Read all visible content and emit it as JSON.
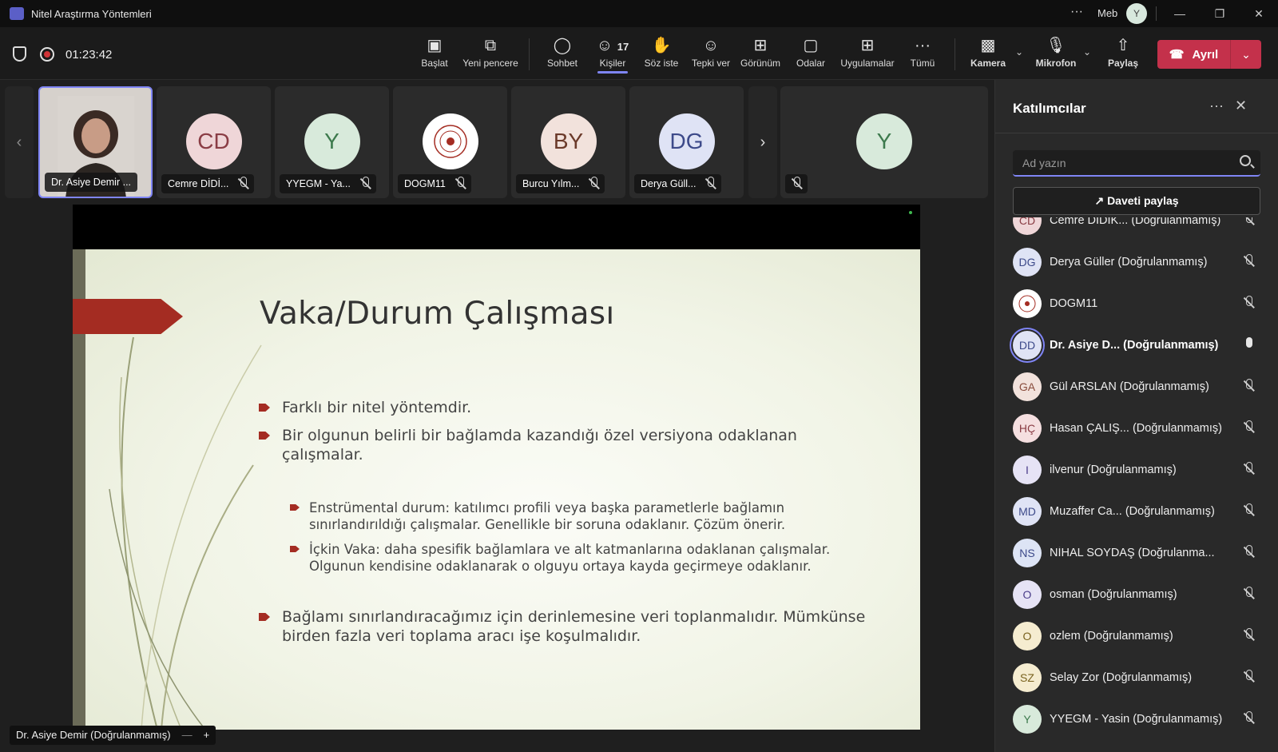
{
  "window": {
    "title": "Nitel Araştırma Yöntemleri",
    "org": "Meb",
    "account_initial": "Y",
    "more": "···"
  },
  "toolbar": {
    "timer": "01:23:42",
    "buttons": [
      {
        "label": "Başlat",
        "icon": "screen-pointer-icon"
      },
      {
        "label": "Yeni pencere",
        "icon": "new-window-icon"
      },
      {
        "label": "Sohbet",
        "icon": "chat-icon"
      },
      {
        "label": "Kişiler",
        "icon": "people-icon",
        "count": "17"
      },
      {
        "label": "Söz iste",
        "icon": "raise-hand-icon"
      },
      {
        "label": "Tepki ver",
        "icon": "reaction-icon"
      },
      {
        "label": "Görünüm",
        "icon": "view-icon"
      },
      {
        "label": "Odalar",
        "icon": "rooms-icon"
      },
      {
        "label": "Uygulamalar",
        "icon": "apps-icon"
      },
      {
        "label": "Tümü",
        "icon": "more-icon"
      },
      {
        "label": "Kamera",
        "icon": "camera-off-icon"
      },
      {
        "label": "Mikrofon",
        "icon": "mic-off-icon"
      },
      {
        "label": "Paylaş",
        "icon": "share-icon"
      }
    ],
    "leave_label": "Ayrıl"
  },
  "gallery": {
    "tiles": [
      {
        "name": "Dr. Asiye Demir ...",
        "initials": "",
        "color": "#d6d1cc"
      },
      {
        "name": "Cemre DİDİ...",
        "initials": "CD",
        "color": "#efd6d8"
      },
      {
        "name": "YYEGM - Ya...",
        "initials": "Y",
        "color": "#d8eadb"
      },
      {
        "name": "DOGM11",
        "initials": "",
        "color": "#ffffff"
      },
      {
        "name": "Burcu Yılm...",
        "initials": "BY",
        "color": "#f2e2dc"
      },
      {
        "name": "Derya Güll...",
        "initials": "DG",
        "color": "#dfe3f5"
      },
      {
        "name": "",
        "initials": "Y",
        "color": "#d8eadb"
      }
    ]
  },
  "slide": {
    "title": "Vaka/Durum Çalışması",
    "bullets": [
      "Farklı bir nitel yöntemdir.",
      "Bir olgunun belirli bir bağlamda kazandığı özel versiyona odaklanan çalışmalar."
    ],
    "sub_bullets": [
      "Enstrümental durum: katılımcı profili veya başka parametlerle bağlamın sınırlandırıldığı çalışmalar. Genellikle bir soruna odaklanır. Çözüm önerir.",
      "İçkin Vaka: daha spesifik bağlamlara ve alt katmanlarına odaklanan çalışmalar. Olgunun kendisine odaklanarak o olguyu ortaya kayda geçirmeye odaklanır."
    ],
    "final_bullet": "Bağlamı sınırlandıracağımız için derinlemesine veri toplanmalıdır. Mümkünse birden fazla veri toplama aracı işe koşulmalıdır."
  },
  "caption": {
    "presenter": "Dr. Asiye Demir (Doğrulanmamış)",
    "minus": "—",
    "plus": "+"
  },
  "panel": {
    "title": "Katılımcılar",
    "search_placeholder": "Ad yazın",
    "invite_label": "Daveti paylaş",
    "participants": [
      {
        "initials": "CD",
        "name": "Cemre DİDİK... (Doğrulanmamış)",
        "color": "#efd6d8",
        "fg": "#8a3d45",
        "mic": "off"
      },
      {
        "initials": "DG",
        "name": "Derya Güller (Doğrulanmamış)",
        "color": "#dfe3f5",
        "fg": "#3d4a8a",
        "mic": "off"
      },
      {
        "initials": "",
        "name": "DOGM11",
        "color": "#ffffff",
        "fg": "#a42c22",
        "mic": "off"
      },
      {
        "initials": "DD",
        "name": "Dr. Asiye D...",
        "suffix": " (Doğrulanmamış)",
        "color": "#dfe3f5",
        "fg": "#3d4a8a",
        "mic": "on",
        "active": true
      },
      {
        "initials": "GA",
        "name": "Gül ARSLAN (Doğrulanmamış)",
        "color": "#f2e2dc",
        "fg": "#8a4d3d",
        "mic": "off"
      },
      {
        "initials": "HÇ",
        "name": "Hasan ÇALIŞ... (Doğrulanmamış)",
        "color": "#f5dfe0",
        "fg": "#8a3d45",
        "mic": "off"
      },
      {
        "initials": "I",
        "name": "ilvenur (Doğrulanmamış)",
        "color": "#e6e3f5",
        "fg": "#4a3d8a",
        "mic": "off"
      },
      {
        "initials": "MD",
        "name": "Muzaffer Ca... (Doğrulanmamış)",
        "color": "#dfe3f5",
        "fg": "#3d4a8a",
        "mic": "off"
      },
      {
        "initials": "NS",
        "name": "NİHAL SOYDAŞ (Doğrulanma...",
        "color": "#dde4f5",
        "fg": "#3d4a8a",
        "mic": "off"
      },
      {
        "initials": "O",
        "name": "osman (Doğrulanmamış)",
        "color": "#e6e3f5",
        "fg": "#4a3d8a",
        "mic": "off"
      },
      {
        "initials": "O",
        "name": "ozlem (Doğrulanmamış)",
        "color": "#f5ecd0",
        "fg": "#7a6320",
        "mic": "off"
      },
      {
        "initials": "SZ",
        "name": "Selay Zor (Doğrulanmamış)",
        "color": "#f5ecd0",
        "fg": "#7a6320",
        "mic": "off"
      },
      {
        "initials": "Y",
        "name": "YYEGM - Yasin (Doğrulanmamış)",
        "color": "#d8eadb",
        "fg": "#3d7a4d",
        "mic": "off"
      }
    ]
  }
}
